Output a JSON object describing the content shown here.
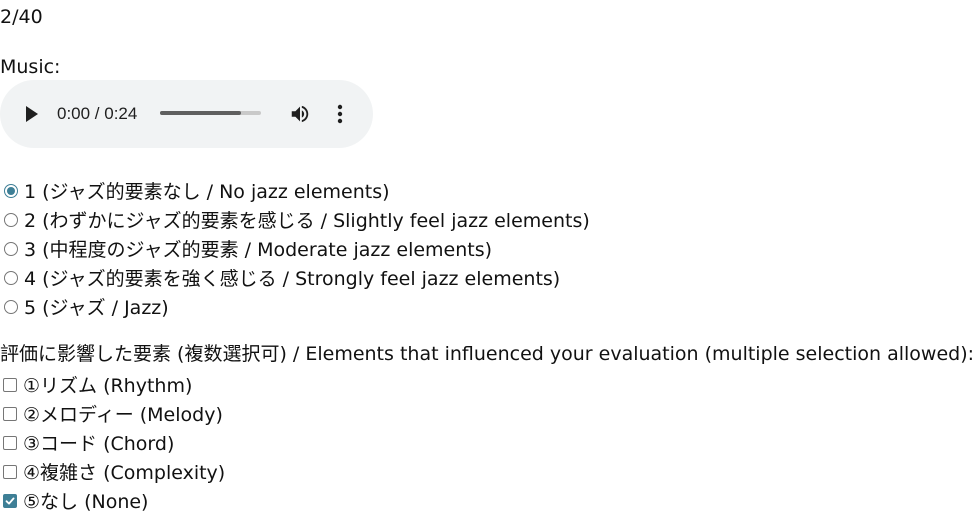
{
  "progress": "2/40",
  "music_label": "Music:",
  "audio": {
    "time": "0:00 / 0:24",
    "seek_fraction": 0.8
  },
  "rating": {
    "options": [
      {
        "label": "1 (ジャズ的要素なし / No jazz elements)",
        "checked": true
      },
      {
        "label": "2 (わずかにジャズ的要素を感じる / Slightly feel jazz elements)",
        "checked": false
      },
      {
        "label": "3 (中程度のジャズ的要素 / Moderate jazz elements)",
        "checked": false
      },
      {
        "label": "4 (ジャズ的要素を強く感じる / Strongly feel jazz elements)",
        "checked": false
      },
      {
        "label": "5 (ジャズ / Jazz)",
        "checked": false
      }
    ]
  },
  "elements": {
    "label": "評価に影響した要素 (複数選択可) / Elements that influenced your evaluation (multiple selection allowed):",
    "options": [
      {
        "label": "①リズム (Rhythm)",
        "checked": false
      },
      {
        "label": "②メロディー (Melody)",
        "checked": false
      },
      {
        "label": "③コード (Chord)",
        "checked": false
      },
      {
        "label": "④複雑さ (Complexity)",
        "checked": false
      },
      {
        "label": "⑤なし (None)",
        "checked": true
      }
    ]
  },
  "colors": {
    "accent": "#3e7f96",
    "player_background": "#f1f3f4"
  }
}
